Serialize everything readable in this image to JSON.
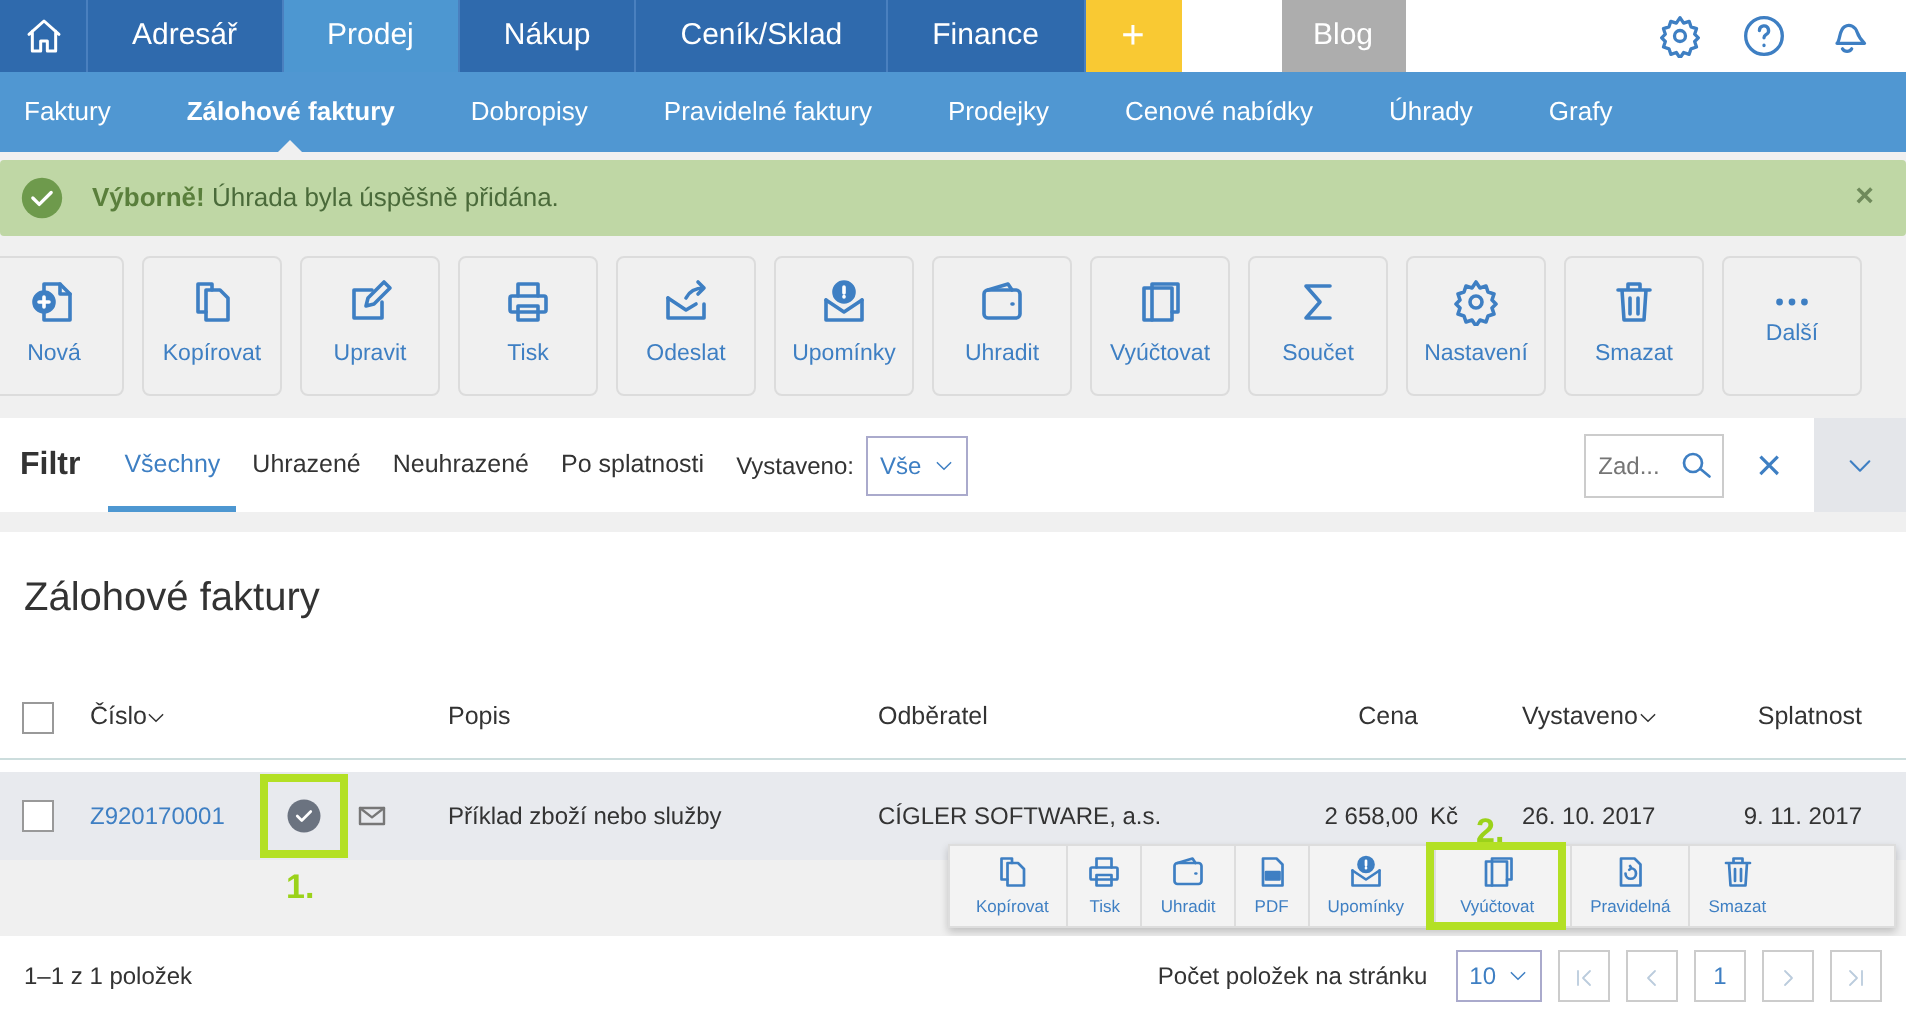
{
  "top_nav": [
    {
      "label": "Adresář",
      "selected": false
    },
    {
      "label": "Prodej",
      "selected": true
    },
    {
      "label": "Nákup",
      "selected": false
    },
    {
      "label": "Ceník/Sklad",
      "selected": false
    },
    {
      "label": "Finance",
      "selected": false
    }
  ],
  "add_button": "+",
  "blog_button": "Blog",
  "sub_nav": [
    {
      "label": "Faktury",
      "selected": false
    },
    {
      "label": "Zálohové faktury",
      "selected": true
    },
    {
      "label": "Dobropisy",
      "selected": false
    },
    {
      "label": "Pravidelné faktury",
      "selected": false
    },
    {
      "label": "Prodejky",
      "selected": false
    },
    {
      "label": "Cenové nabídky",
      "selected": false
    },
    {
      "label": "Úhrady",
      "selected": false
    },
    {
      "label": "Grafy",
      "selected": false
    }
  ],
  "alert": {
    "text": "**Výborně!** Úhrada byla úspěšně přidána.",
    "close": "×"
  },
  "toolbar": [
    "Nová",
    "Kopírovat",
    "Upravit",
    "Tisk",
    "Odeslat",
    "Upomínky",
    "Uhradit",
    "Vyúčtovat",
    "Součet",
    "Nastavení",
    "Smazat",
    "Další"
  ],
  "filter": {
    "title": "Filtr",
    "tabs": [
      {
        "label": "Všechny",
        "selected": true
      },
      {
        "label": "Uhrazené",
        "selected": false
      },
      {
        "label": "Neuhrazené",
        "selected": false
      },
      {
        "label": "Po splatnosti",
        "selected": false
      }
    ],
    "issued_label": "Vystaveno:",
    "issued_value": "Vše",
    "search_placeholder": "Zad...",
    "clear": "×"
  },
  "page_title": "Zálohové faktury",
  "table": {
    "select_all_checked": false,
    "columns": [
      "Číslo",
      "Popis",
      "Odběratel",
      "Cena",
      "Vystaveno",
      "Splatnost"
    ],
    "rows": [
      {
        "checked": false,
        "number": "Z920170001",
        "paid": true,
        "description": "Příklad zboží nebo služby",
        "customer": "CÍGLER SOFTWARE, a.s.",
        "price": "2 658,00",
        "currency": "Kč",
        "issued": "26. 10. 2017",
        "due": "9. 11. 2017"
      }
    ]
  },
  "row_actions": [
    {
      "label": "Kopírovat",
      "highlighted": false
    },
    {
      "label": "Tisk",
      "highlighted": false
    },
    {
      "label": "Uhradit",
      "highlighted": false
    },
    {
      "label": "PDF",
      "highlighted": false
    },
    {
      "label": "Upomínky",
      "highlighted": false
    },
    {
      "label": "Vyúčtovat",
      "highlighted": true
    },
    {
      "label": "Pravidelná",
      "highlighted": false
    },
    {
      "label": "Smazat",
      "highlighted": false
    }
  ],
  "annotations": [
    "1.",
    "2."
  ],
  "footer": {
    "count": "1–1 z 1 položek",
    "page_size_label": "Počet položek na stránku",
    "page_size": "10",
    "current_page": "1"
  }
}
